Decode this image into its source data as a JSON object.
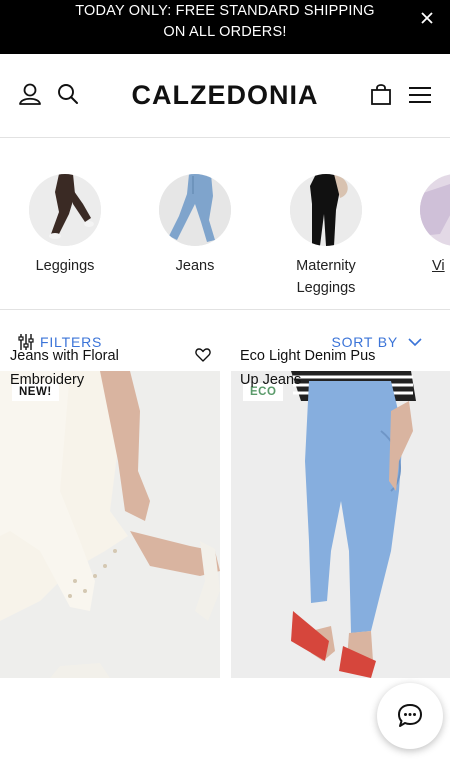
{
  "promo": {
    "line1": "TODAY ONLY: FREE STANDARD SHIPPING",
    "line2": "ON ALL ORDERS!"
  },
  "header": {
    "brand": "CALZEDONIA",
    "icons": [
      "user-icon",
      "search-icon",
      "shopping-bag-icon",
      "hamburger-menu-icon"
    ]
  },
  "categories": [
    {
      "label": "Leggings"
    },
    {
      "label": "Jeans"
    },
    {
      "label": "Maternity Leggings",
      "line1": "Maternity",
      "line2": "Leggings"
    },
    {
      "label": "Vi"
    }
  ],
  "filterbar": {
    "filters_label": "FILTERS",
    "sort_label": "SORT BY"
  },
  "products": [
    {
      "badge": "NEW!",
      "name_line1": "Jeans with Floral",
      "name_line2": "Embroidery"
    },
    {
      "badge": "ECO",
      "badge_color": "#5a9a6a",
      "name_line1": "Eco Light Denim Pus",
      "name_line2": "Up Jeans"
    }
  ],
  "colors": {
    "accent": "#3b74d8",
    "promo_bg": "#000000"
  }
}
